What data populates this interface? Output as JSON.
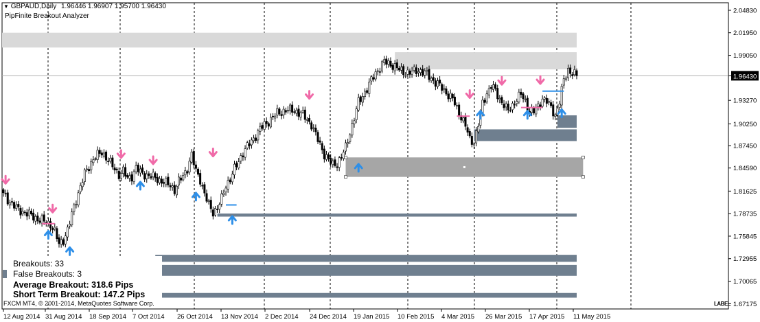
{
  "header": {
    "title": "GBPAUD,Daily",
    "ohlc": "1.96446 1.96907 1.95700 1.96430",
    "indicator": "PipFinite Breakout Analyzer"
  },
  "stats": {
    "breakouts": "Breakouts: 33",
    "false_breakouts": "False Breakouts: 3",
    "average": "Average Breakout: 318.6 Pips",
    "short_term": "Short Term Breakout: 147.2 Pips"
  },
  "copyright": "FXCM MT4, © 2001-2014, MetaQuotes Software Corp.",
  "corner_label": "LABEL",
  "colors": {
    "bull": "#2e8fe8",
    "bear": "#f06aa8",
    "zone_light": "#d9d9d9",
    "zone_mid": "#a6a6a6",
    "zone_dark": "#6f7f8f"
  },
  "chart_data": {
    "type": "candlestick",
    "symbol": "GBPAUD",
    "timeframe": "Daily",
    "current_price": 1.9643,
    "current_price_label": "1.96430",
    "ylim": [
      1.665,
      2.058
    ],
    "y_ticks": [
      "2.04830",
      "2.01950",
      "1.99050",
      "1.96430",
      "1.93270",
      "1.90250",
      "1.87450",
      "1.84590",
      "1.81625",
      "1.78735",
      "1.75845",
      "1.72955",
      "1.70065",
      "1.67175"
    ],
    "x_ticks": [
      "12 Aug 2014",
      "31 Aug 2014",
      "18 Sep 2014",
      "7 Oct 2014",
      "26 Oct 2014",
      "13 Nov 2014",
      "2 Dec 2014",
      "24 Dec 2014",
      "19 Jan 2015",
      "10 Feb 2015",
      "4 Mar 2015",
      "26 Mar 2015",
      "17 Apr 2015",
      "11 May 2015"
    ],
    "close_anchors": [
      [
        0,
        1.812
      ],
      [
        6,
        1.794
      ],
      [
        12,
        1.786
      ],
      [
        18,
        1.778
      ],
      [
        22,
        1.774
      ],
      [
        24,
        1.764
      ],
      [
        26,
        1.748
      ],
      [
        28,
        1.754
      ],
      [
        30,
        1.766
      ],
      [
        34,
        1.806
      ],
      [
        38,
        1.838
      ],
      [
        42,
        1.858
      ],
      [
        46,
        1.866
      ],
      [
        48,
        1.86
      ],
      [
        50,
        1.852
      ],
      [
        52,
        1.844
      ],
      [
        54,
        1.838
      ],
      [
        56,
        1.842
      ],
      [
        58,
        1.832
      ],
      [
        60,
        1.836
      ],
      [
        62,
        1.846
      ],
      [
        64,
        1.84
      ],
      [
        68,
        1.836
      ],
      [
        72,
        1.832
      ],
      [
        76,
        1.826
      ],
      [
        78,
        1.824
      ],
      [
        80,
        1.818
      ],
      [
        82,
        1.828
      ],
      [
        84,
        1.836
      ],
      [
        86,
        1.846
      ],
      [
        88,
        1.862
      ],
      [
        90,
        1.842
      ],
      [
        92,
        1.832
      ],
      [
        94,
        1.812
      ],
      [
        96,
        1.798
      ],
      [
        98,
        1.79
      ],
      [
        100,
        1.794
      ],
      [
        102,
        1.806
      ],
      [
        104,
        1.824
      ],
      [
        106,
        1.832
      ],
      [
        108,
        1.844
      ],
      [
        112,
        1.866
      ],
      [
        116,
        1.88
      ],
      [
        120,
        1.896
      ],
      [
        124,
        1.906
      ],
      [
        128,
        1.916
      ],
      [
        132,
        1.92
      ],
      [
        136,
        1.92
      ],
      [
        140,
        1.914
      ],
      [
        144,
        1.902
      ],
      [
        146,
        1.888
      ],
      [
        148,
        1.876
      ],
      [
        150,
        1.864
      ],
      [
        152,
        1.856
      ],
      [
        154,
        1.85
      ],
      [
        156,
        1.852
      ],
      [
        158,
        1.86
      ],
      [
        160,
        1.872
      ],
      [
        162,
        1.892
      ],
      [
        164,
        1.91
      ],
      [
        166,
        1.93
      ],
      [
        170,
        1.948
      ],
      [
        174,
        1.968
      ],
      [
        178,
        1.982
      ],
      [
        182,
        1.978
      ],
      [
        186,
        1.97
      ],
      [
        190,
        1.968
      ],
      [
        194,
        1.972
      ],
      [
        198,
        1.966
      ],
      [
        202,
        1.956
      ],
      [
        206,
        1.946
      ],
      [
        210,
        1.934
      ],
      [
        212,
        1.922
      ],
      [
        214,
        1.912
      ],
      [
        216,
        1.9
      ],
      [
        218,
        1.882
      ],
      [
        220,
        1.88
      ],
      [
        222,
        1.902
      ],
      [
        224,
        1.928
      ],
      [
        226,
        1.942
      ],
      [
        228,
        1.952
      ],
      [
        230,
        1.944
      ],
      [
        232,
        1.934
      ],
      [
        234,
        1.928
      ],
      [
        236,
        1.918
      ],
      [
        238,
        1.926
      ],
      [
        240,
        1.936
      ],
      [
        242,
        1.94
      ],
      [
        244,
        1.93
      ],
      [
        246,
        1.92
      ],
      [
        248,
        1.918
      ],
      [
        250,
        1.924
      ],
      [
        252,
        1.936
      ],
      [
        254,
        1.932
      ],
      [
        256,
        1.922
      ],
      [
        258,
        1.914
      ],
      [
        260,
        1.932
      ],
      [
        262,
        1.958
      ],
      [
        264,
        1.972
      ],
      [
        266,
        1.968
      ],
      [
        268,
        1.9643
      ]
    ],
    "zones": [
      {
        "kind": "supply",
        "from_bar": 0,
        "to_bar": 268,
        "y1": 2.0195,
        "y2": 2.0005
      },
      {
        "kind": "supply",
        "from_bar": 183,
        "to_bar": 268,
        "y1": 1.9945,
        "y2": 1.9725
      },
      {
        "kind": "demand",
        "from_bar": 220,
        "to_bar": 268,
        "y1": 1.8955,
        "y2": 1.8805
      },
      {
        "kind": "demand",
        "from_bar": 259,
        "to_bar": 268,
        "y1": 1.9135,
        "y2": 1.8975
      },
      {
        "kind": "demand_selected",
        "from_bar": 160,
        "to_bar": 271,
        "y1": 1.8595,
        "y2": 1.8345
      },
      {
        "kind": "demand",
        "from_bar": 100,
        "to_bar": 268,
        "y1": 1.7875,
        "y2": 1.7835
      },
      {
        "kind": "demand",
        "from_bar": 71,
        "to_bar": 268,
        "y1": 1.7345,
        "y2": 1.7255
      },
      {
        "kind": "demand",
        "from_bar": 71,
        "to_bar": 268,
        "y1": 1.7215,
        "y2": 1.7075
      },
      {
        "kind": "demand",
        "from_bar": 71,
        "to_bar": 268,
        "y1": 1.6855,
        "y2": 1.6795
      }
    ],
    "arrows": [
      {
        "bar": 1,
        "dir": "down",
        "price": 1.826
      },
      {
        "bar": 21,
        "dir": "up",
        "price": 1.765
      },
      {
        "bar": 23,
        "dir": "down",
        "price": 1.789
      },
      {
        "bar": 31,
        "dir": "up",
        "price": 1.744
      },
      {
        "bar": 55,
        "dir": "down",
        "price": 1.859
      },
      {
        "bar": 64,
        "dir": "up",
        "price": 1.828
      },
      {
        "bar": 70,
        "dir": "down",
        "price": 1.851
      },
      {
        "bar": 90,
        "dir": "up",
        "price": 1.814
      },
      {
        "bar": 98,
        "dir": "down",
        "price": 1.861
      },
      {
        "bar": 107,
        "dir": "up",
        "price": 1.784
      },
      {
        "bar": 143,
        "dir": "down",
        "price": 1.935
      },
      {
        "bar": 166,
        "dir": "up",
        "price": 1.851
      },
      {
        "bar": 218,
        "dir": "down",
        "price": 1.936
      },
      {
        "bar": 223,
        "dir": "up",
        "price": 1.919
      },
      {
        "bar": 233,
        "dir": "down",
        "price": 1.953
      },
      {
        "bar": 245,
        "dir": "up",
        "price": 1.919
      },
      {
        "bar": 251,
        "dir": "down",
        "price": 1.954
      },
      {
        "bar": 261,
        "dir": "up",
        "price": 1.921
      }
    ],
    "steps": [
      {
        "color": "bear",
        "from_bar": 18,
        "to_bar": 24,
        "price": 1.7745
      },
      {
        "color": "bull",
        "from_bar": 104,
        "to_bar": 109,
        "price": 1.7985
      },
      {
        "color": "bear",
        "from_bar": 212,
        "to_bar": 218,
        "price": 1.9125
      },
      {
        "color": "bear",
        "from_bar": 242,
        "to_bar": 252,
        "price": 1.9235
      },
      {
        "color": "bull",
        "from_bar": 252,
        "to_bar": 262,
        "price": 1.9445
      }
    ]
  }
}
